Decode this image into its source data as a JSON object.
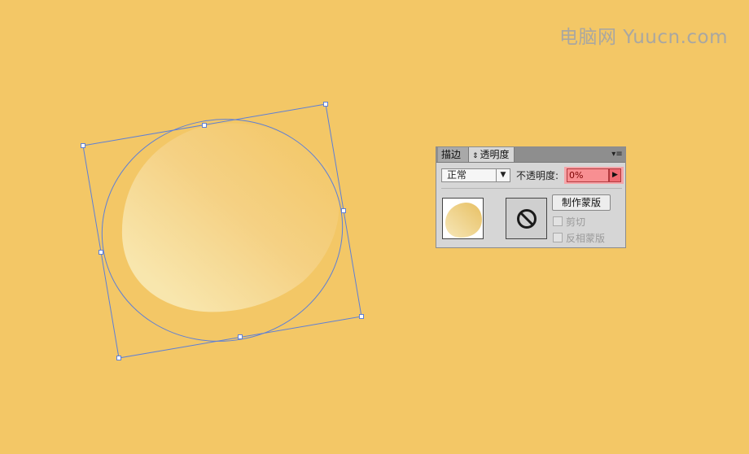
{
  "watermark": "电脑网 Yuucn.com",
  "colors": {
    "canvas_background": "#f3c766",
    "selection_outline": "#5d7fd6",
    "opacity_highlight": "#f88f92"
  },
  "panel": {
    "tabs": [
      {
        "label": "描边",
        "active": false
      },
      {
        "label": "透明度",
        "active": true,
        "icon": "updown-arrows-icon"
      }
    ],
    "menu_icon": "panel-menu-icon",
    "blend_mode": {
      "value": "正常"
    },
    "opacity": {
      "label": "不透明度",
      "value": "0%"
    },
    "make_mask_button": "制作蒙版",
    "options": [
      {
        "label": "剪切",
        "checked": false,
        "enabled": false
      },
      {
        "label": "反相蒙版",
        "checked": false,
        "enabled": false
      }
    ],
    "mask_thumbnail_icon": "no-symbol-icon"
  }
}
